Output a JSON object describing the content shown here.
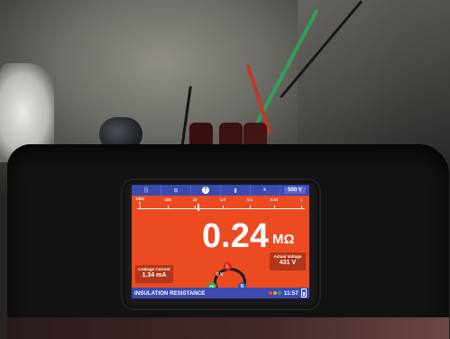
{
  "topbar": {
    "slots": [
      "|||",
      "⊞",
      "?",
      "▮",
      "🔇︎"
    ],
    "range_label": "500 V"
  },
  "scale": {
    "labels": [
      "100k",
      "100",
      "10",
      "1.0",
      "0.1",
      "0.01",
      "1"
    ],
    "top_label": "1000",
    "units_label": "k",
    "pointer_fraction": 0.36
  },
  "reading": {
    "value": "0.24",
    "unit": "MΩ"
  },
  "leakage": {
    "label": "Leakage Current",
    "value": "1.34 mA"
  },
  "actual_voltage": {
    "label": "Actual Voltage",
    "value": "431 V"
  },
  "terminals": {
    "voltage": "0 V",
    "line": "L",
    "pe": "PE",
    "neutral": "N"
  },
  "bottombar": {
    "mode": "INSULATION RESISTANCE",
    "time": "11:57",
    "status_dot_colors": [
      "#e64a2a",
      "#f2a61b",
      "#3aa34b"
    ]
  },
  "colors": {
    "screen": "#ec4a21",
    "bar": "#3b4bb0"
  }
}
